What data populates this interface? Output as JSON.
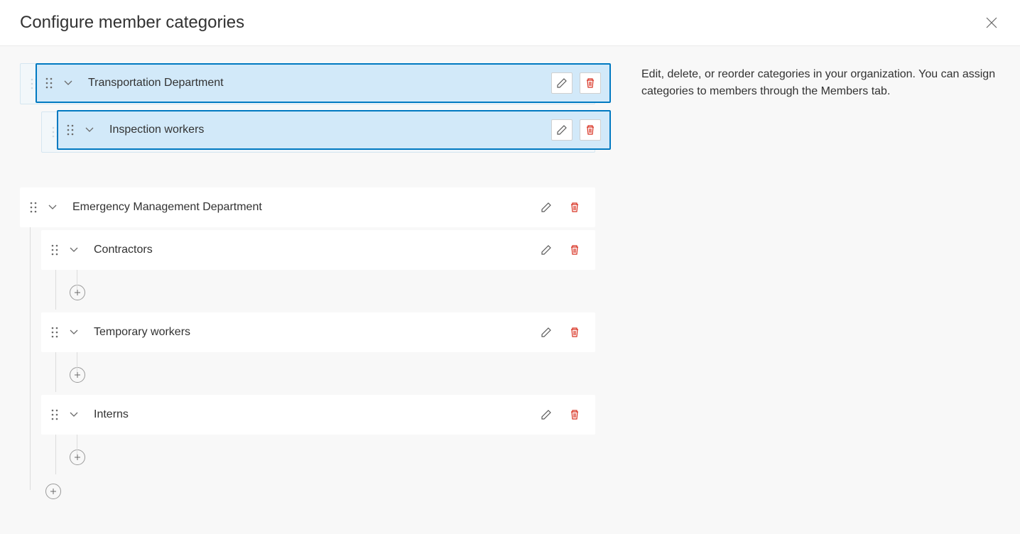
{
  "header": {
    "title": "Configure member categories"
  },
  "help": {
    "text": "Edit, delete, or reorder categories in your organization. You can assign categories to members through the Members tab."
  },
  "categories": {
    "dragging": {
      "root_label": "Transportation Department",
      "child_label": "Inspection workers"
    },
    "ghost": {
      "root_label": "Transportation Department",
      "child_label": "Inspection workers"
    },
    "static": {
      "root_label": "Emergency Management Department",
      "children": [
        {
          "label": "Contractors"
        },
        {
          "label": "Temporary workers"
        },
        {
          "label": "Interns"
        }
      ]
    }
  }
}
